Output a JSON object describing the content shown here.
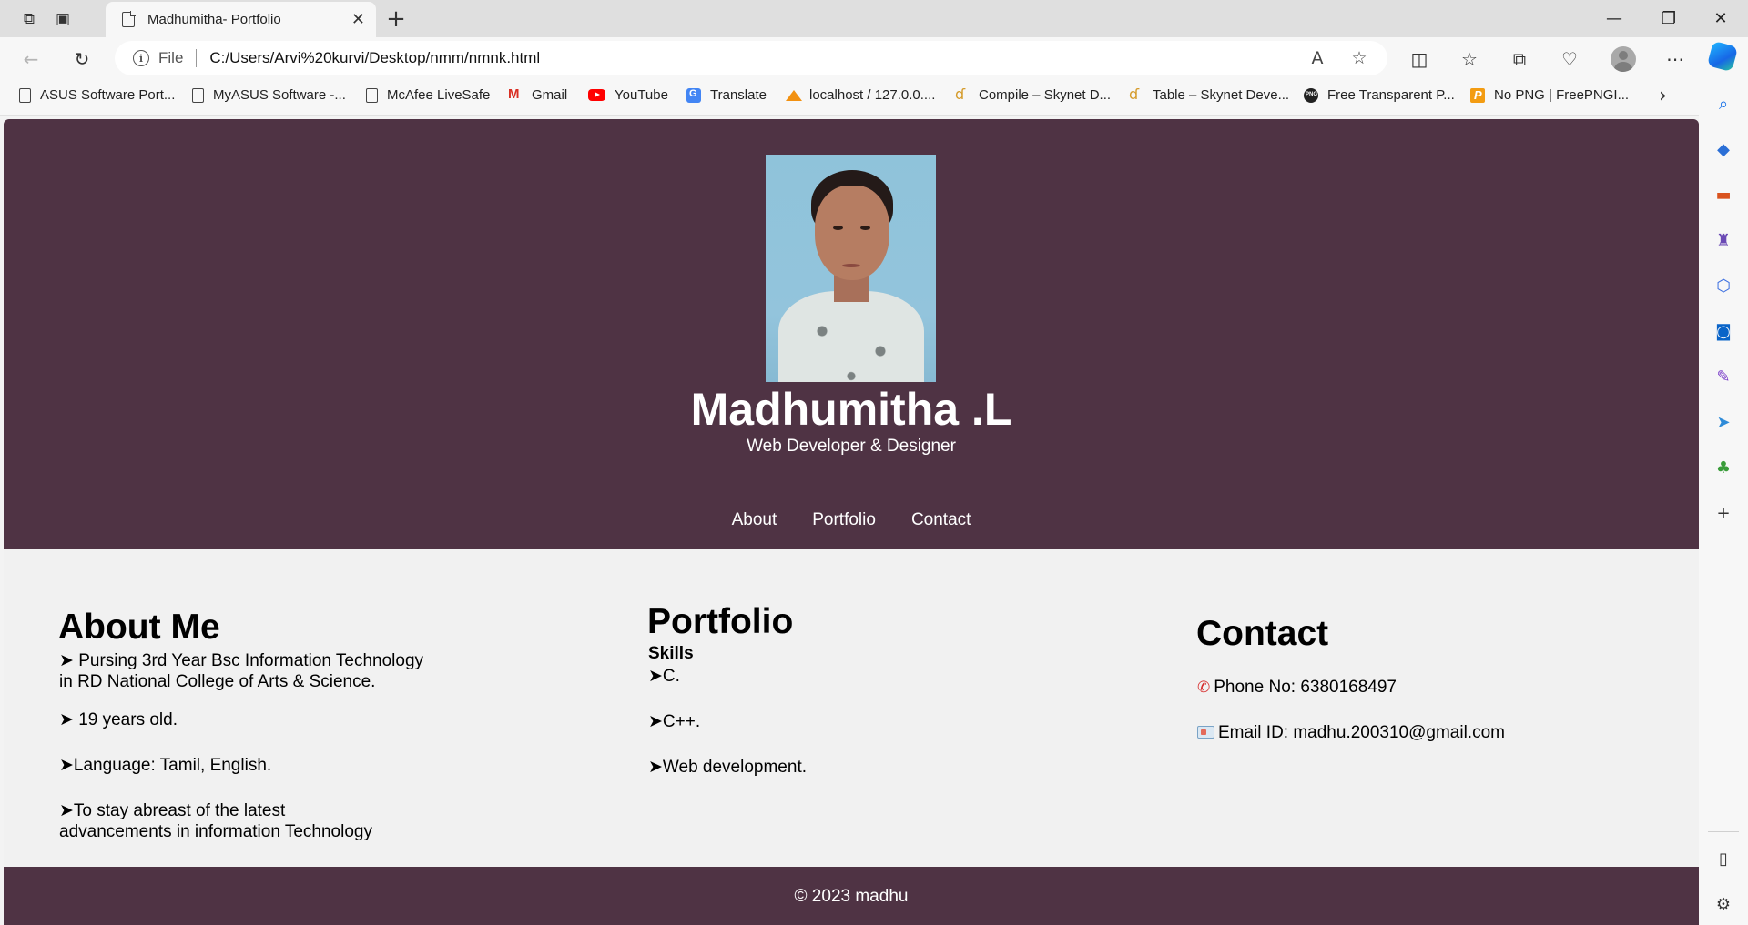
{
  "browser": {
    "tab_title": "Madhumitha- Portfolio",
    "address_scheme_label": "File",
    "url": "C:/Users/Arvi%20kurvi/Desktop/nmm/nmnk.html"
  },
  "bookmarks": [
    {
      "label": "ASUS Software Port...",
      "icon": "page-icon"
    },
    {
      "label": "MyASUS Software -...",
      "icon": "page-icon"
    },
    {
      "label": "McAfee LiveSafe",
      "icon": "page-icon"
    },
    {
      "label": "Gmail",
      "icon": "gmail-icon"
    },
    {
      "label": "YouTube",
      "icon": "youtube-icon"
    },
    {
      "label": "Translate",
      "icon": "translate-icon"
    },
    {
      "label": "localhost / 127.0.0....",
      "icon": "phpmyadmin-icon"
    },
    {
      "label": "Compile – Skynet D...",
      "icon": "skynet-icon"
    },
    {
      "label": "Table – Skynet Deve...",
      "icon": "skynet-icon"
    },
    {
      "label": "Free Transparent P...",
      "icon": "png-icon"
    },
    {
      "label": "No PNG | FreePNGI...",
      "icon": "freepng-icon"
    }
  ],
  "site": {
    "name": "Madhumitha .L",
    "tagline": "Web Developer & Designer",
    "nav": [
      "About",
      "Portfolio",
      "Contact"
    ],
    "about": {
      "title": "About Me",
      "line1": "➤ Pursing 3rd Year Bsc Information Technology",
      "line2": "in RD National College of Arts & Science.",
      "line3": "➤ 19 years old.",
      "line4": "➤Language: Tamil, English.",
      "line5": "➤To stay abreast of the latest",
      "line6": "advancements in information Technology"
    },
    "portfolio": {
      "title": "Portfolio",
      "skills_label": "Skills",
      "skills": [
        "➤C.",
        "➤C++.",
        "➤Web development."
      ]
    },
    "contact": {
      "title": "Contact",
      "phone": "Phone No: 6380168497",
      "email": "Email ID: madhu.200310@gmail.com"
    },
    "footer": "© 2023 madhu"
  },
  "colors": {
    "header_bg": "#4f3344",
    "body_bg": "#f1f1f1"
  }
}
